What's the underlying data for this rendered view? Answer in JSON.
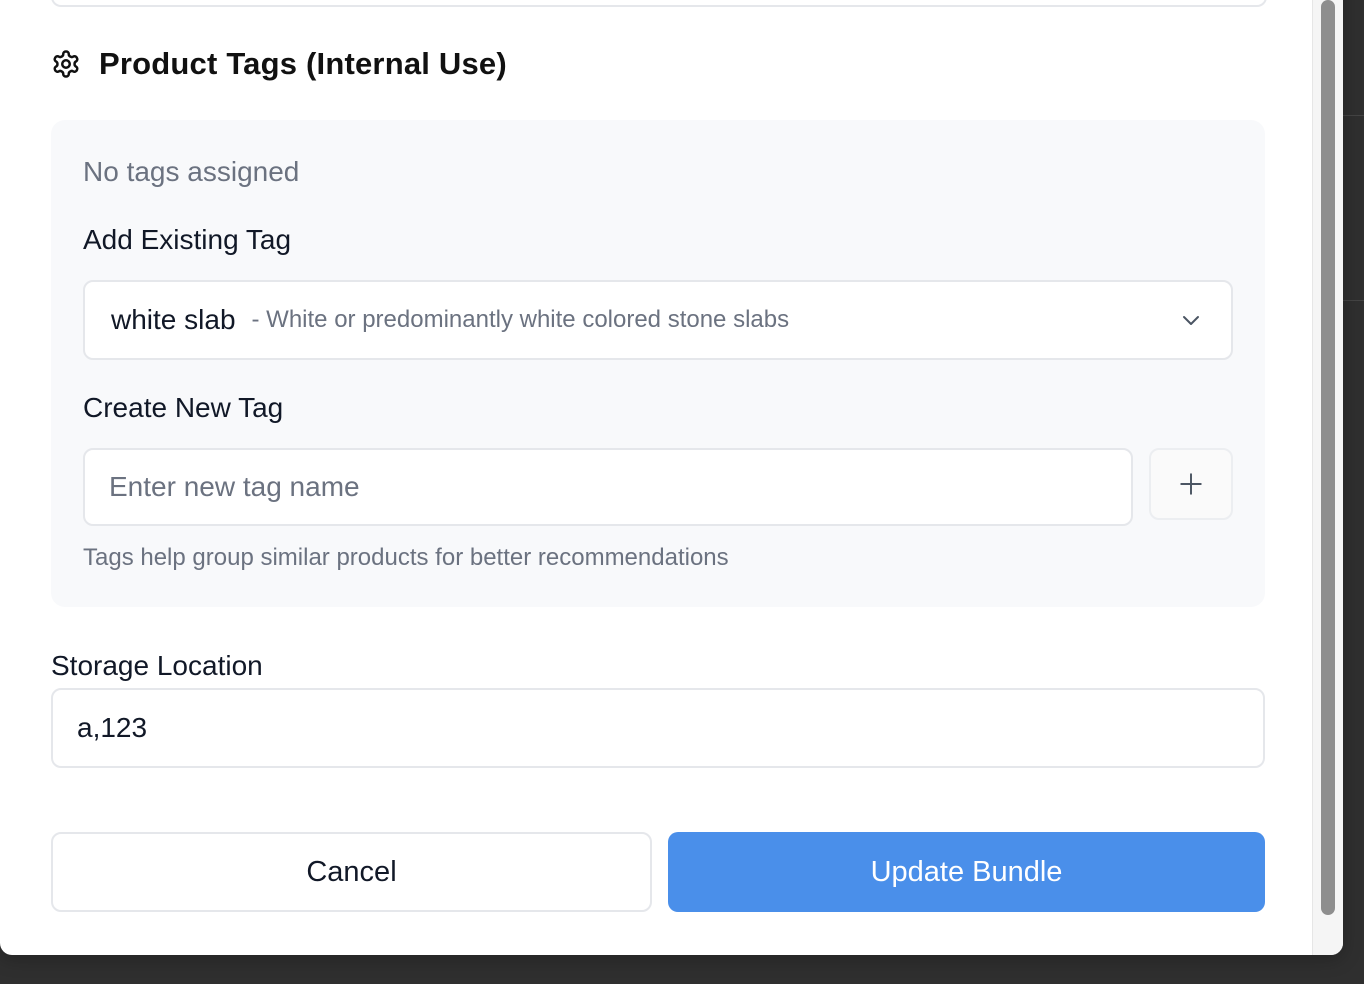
{
  "section": {
    "title": "Product Tags (Internal Use)",
    "icon": "gear-icon"
  },
  "tags": {
    "empty_text": "No tags assigned",
    "existing_label": "Add Existing Tag",
    "selected_tag_name": "white slab",
    "selected_tag_description": "- White or predominantly white colored stone slabs",
    "new_label": "Create New Tag",
    "new_placeholder": "Enter new tag name",
    "add_icon": "plus-icon",
    "helper_text": "Tags help group similar products for better recommendations"
  },
  "storage": {
    "label": "Storage Location",
    "value": "a,123"
  },
  "actions": {
    "cancel_label": "Cancel",
    "submit_label": "Update Bundle"
  },
  "colors": {
    "primary": "#4a8fea",
    "panel_bg": "#f8f9fb",
    "muted_text": "#6b7280",
    "border": "#e5e7eb"
  }
}
